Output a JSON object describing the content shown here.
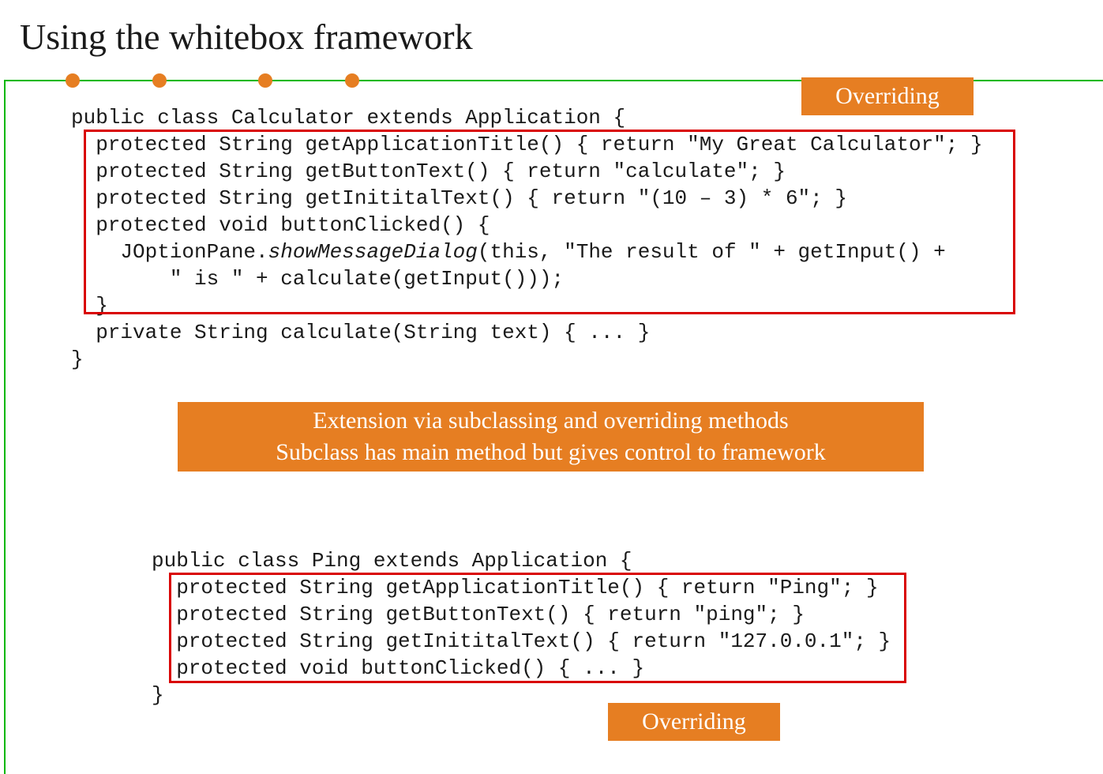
{
  "title": "Using the whitebox framework",
  "labels": {
    "overriding": "Overriding"
  },
  "middle_box": {
    "line1": "Extension via subclassing and overriding methods",
    "line2": "Subclass has main method but gives control to framework"
  },
  "code1": {
    "l1": "public class Calculator extends Application {",
    "l2": "  protected String getApplicationTitle() { return \"My Great Calculator\"; }",
    "l3": "  protected String getButtonText() { return \"calculate\"; }",
    "l4": "  protected String getInititalText() { return \"(10 – 3) * 6\"; }",
    "l5": "  protected void buttonClicked() {",
    "l6a": "    JOptionPane.",
    "l6b": "showMessageDialog",
    "l6c": "(this, \"The result of \" + getInput() +",
    "l7": "        \" is \" + calculate(getInput()));",
    "l8": "  }",
    "l9": "  private String calculate(String text) { ... }",
    "l10": "}"
  },
  "code2": {
    "l1": "public class Ping extends Application {",
    "l2": "  protected String getApplicationTitle() { return \"Ping\"; }",
    "l3": "  protected String getButtonText() { return \"ping\"; }",
    "l4": "  protected String getInititalText() { return \"127.0.0.1\"; }",
    "l5": "  protected void buttonClicked() { ... }",
    "l6": "}"
  }
}
